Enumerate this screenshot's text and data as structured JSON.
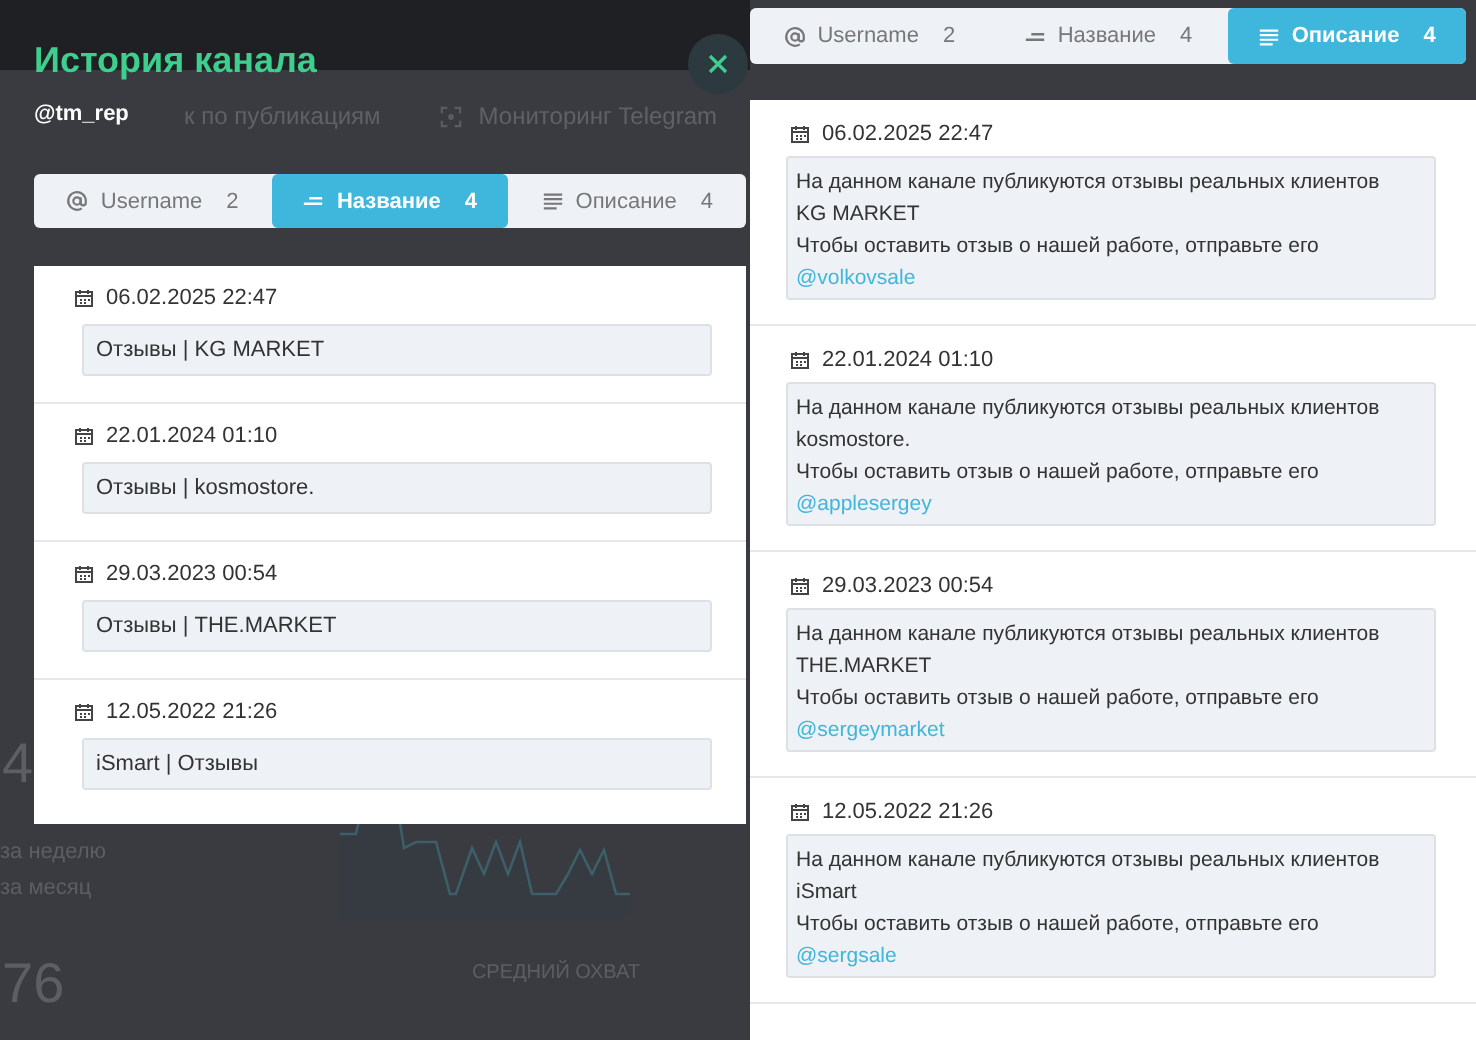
{
  "backdrop": {
    "nav": [
      {
        "label": "к по публикациям",
        "kind": "search"
      },
      {
        "label": "Мониторинг Telegram",
        "kind": "monitor"
      }
    ],
    "stats": {
      "value": "4",
      "periods": [
        "за неделю",
        "за месяц"
      ]
    },
    "reach": {
      "value": "76",
      "label": "СРЕДНИЙ ОХВАТ"
    }
  },
  "history_modal": {
    "title": "История канала",
    "handle": "@tm_rep",
    "tabs": [
      {
        "kind": "username",
        "label": "Username",
        "count": "2",
        "selected": false
      },
      {
        "kind": "title",
        "label": "Название",
        "count": "4",
        "selected": true
      },
      {
        "kind": "description",
        "label": "Описание",
        "count": "4",
        "selected": false
      }
    ],
    "entries": [
      {
        "date": "06.02.2025 22:47",
        "text": "Отзывы | KG MARKET"
      },
      {
        "date": "22.01.2024 01:10",
        "text": "Отзывы | kosmostore."
      },
      {
        "date": "29.03.2023 00:54",
        "text": "Отзывы | THE.MARKET"
      },
      {
        "date": "12.05.2022 21:26",
        "text": "iSmart | Отзывы"
      }
    ]
  },
  "side_panel": {
    "tabs": [
      {
        "kind": "username",
        "label": "Username",
        "count": "2",
        "selected": false
      },
      {
        "kind": "title",
        "label": "Название",
        "count": "4",
        "selected": false
      },
      {
        "kind": "description",
        "label": "Описание",
        "count": "4",
        "selected": true
      }
    ],
    "entries": [
      {
        "date": "06.02.2025 22:47",
        "text": "На данном канале публикуются отзывы реальных клиентов\nKG MARKET\nЧтобы оставить отзыв о нашей работе, отправьте его",
        "link": "@volkovsale"
      },
      {
        "date": "22.01.2024 01:10",
        "text": "На данном канале публикуются отзывы реальных клиентов\nkosmostore.\nЧтобы оставить отзыв о нашей работе, отправьте его",
        "link": "@applesergey"
      },
      {
        "date": "29.03.2023 00:54",
        "text": "На данном канале публикуются отзывы реальных клиентов\nTHE.MARKET\nЧтобы оставить отзыв о нашей работе, отправьте его",
        "link": "@sergeymarket"
      },
      {
        "date": "12.05.2022 21:26",
        "text": "На данном канале публикуются отзывы реальных клиентов\niSmart\nЧтобы оставить отзыв о нашей работе, отправьте его",
        "link": "@sergsale"
      }
    ]
  }
}
